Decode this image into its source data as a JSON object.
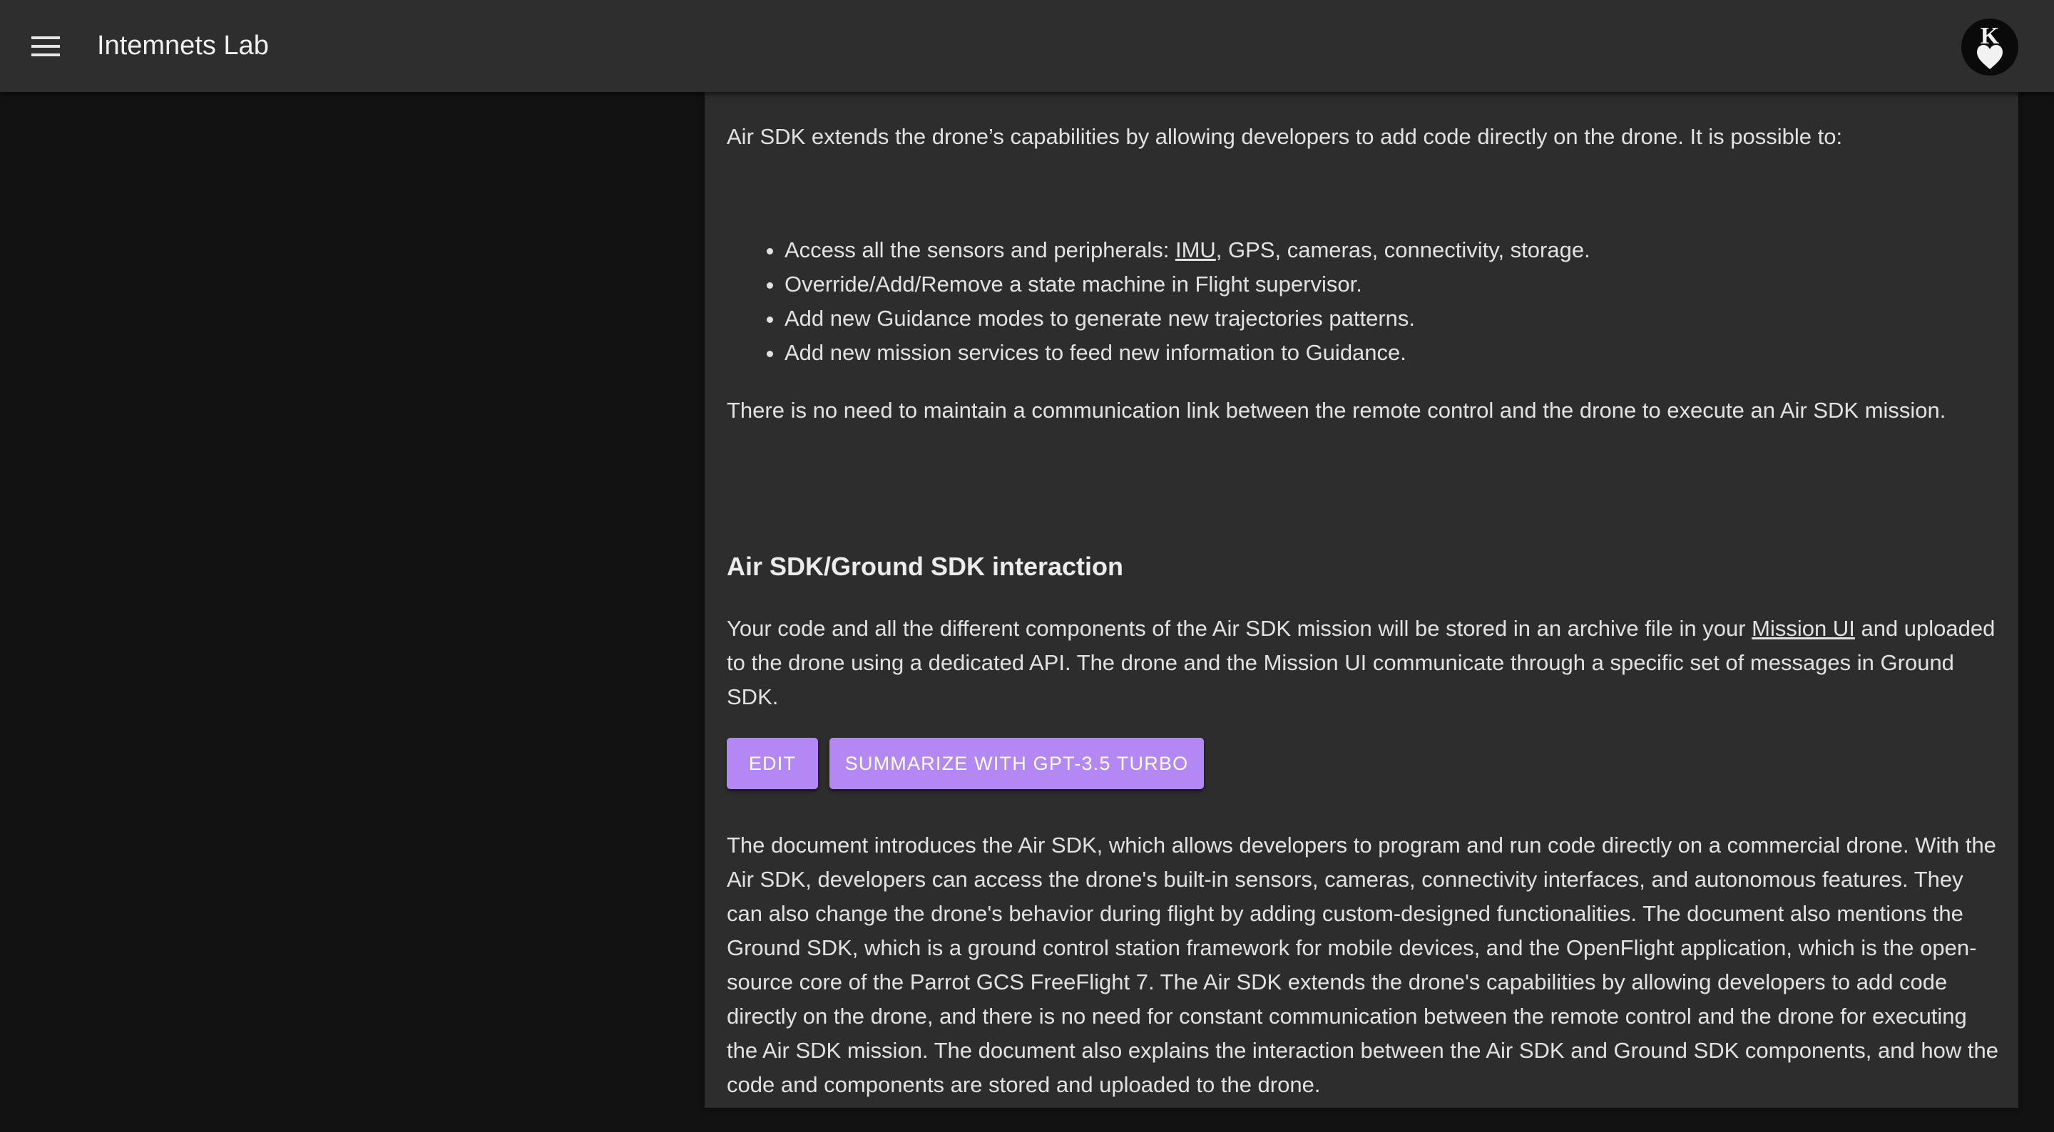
{
  "app": {
    "title": "Intemnets Lab",
    "menu_icon": "hamburger-menu-icon",
    "avatar_letter": "K",
    "avatar_icon": "heart-icon"
  },
  "doc": {
    "intro": "Air SDK extends the drone’s capabilities by allowing developers to add code directly on the drone. It is possible to:",
    "bullets": [
      {
        "before": "Access all the sensors and peripherals: ",
        "link": "IMU",
        "after": ", GPS, cameras, connectivity, storage."
      },
      {
        "text": "Override/Add/Remove a state machine in Flight supervisor."
      },
      {
        "text": "Add new Guidance modes to generate new trajectories patterns."
      },
      {
        "text": "Add new mission services to feed new information to Guidance."
      }
    ],
    "no_link_para": "There is no need to maintain a communication link between the remote control and the drone to execute an Air SDK mission.",
    "section_heading": "Air SDK/Ground SDK interaction",
    "interaction_para": {
      "before": "Your code and all the different components of the Air SDK mission will be stored in an archive file in your ",
      "link": "Mission UI",
      "after": " and uploaded to the drone using a dedicated API. The drone and the Mission UI communicate through a specific set of messages in Ground SDK."
    }
  },
  "actions": {
    "edit_label": "EDIT",
    "summarize_label": "SUMMARIZE WITH GPT-3.5 TURBO",
    "button_color": "#b388f5"
  },
  "summary": {
    "text": "The document introduces the Air SDK, which allows developers to program and run code directly on a commercial drone. With the Air SDK, developers can access the drone's built-in sensors, cameras, connectivity interfaces, and autonomous features. They can also change the drone's behavior during flight by adding custom-designed functionalities. The document also mentions the Ground SDK, which is a ground control station framework for mobile devices, and the OpenFlight application, which is the open-source core of the Parrot GCS FreeFlight 7. The Air SDK extends the drone's capabilities by allowing developers to add code directly on the drone, and there is no need for constant communication between the remote control and the drone for executing the Air SDK mission. The document also explains the interaction between the Air SDK and Ground SDK components, and how the code and components are stored and uploaded to the drone."
  }
}
